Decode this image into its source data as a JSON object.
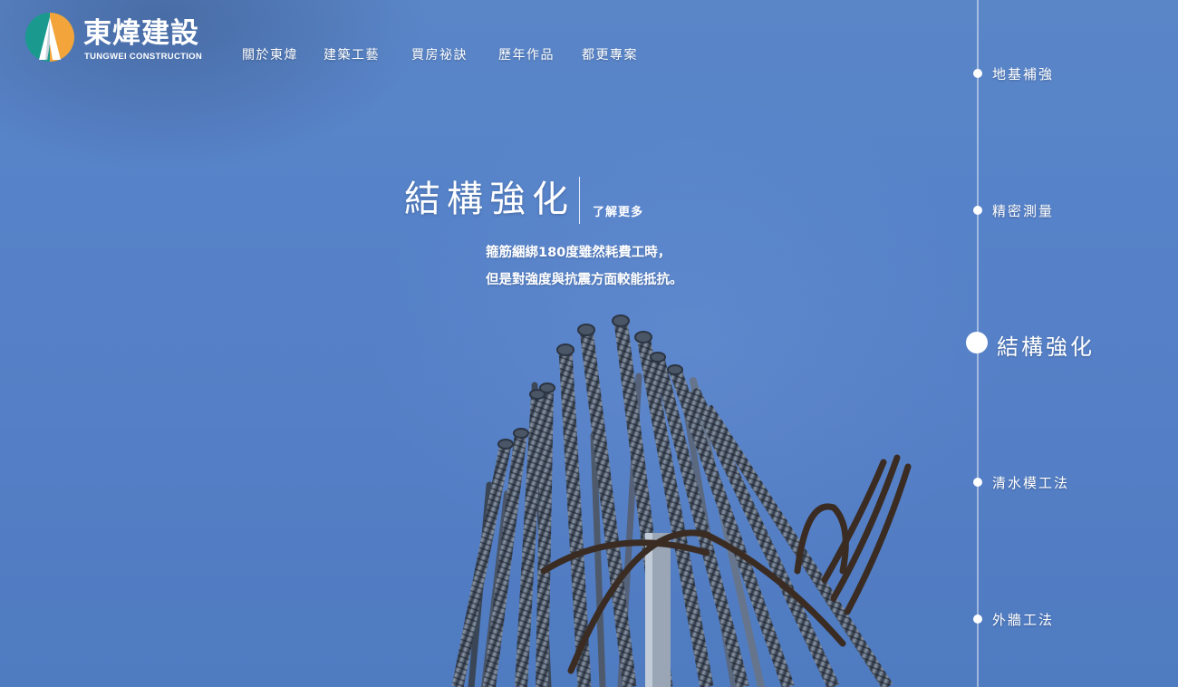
{
  "brand": {
    "name": "東煒建設",
    "subtitle": "TUNGWEI CONSTRUCTION",
    "colors": {
      "teal": "#1a9a8e",
      "orange": "#f3a43a",
      "white": "#ffffff"
    }
  },
  "nav": {
    "items": [
      {
        "label": "關於東煒"
      },
      {
        "label": "建築工藝"
      },
      {
        "label": "買房祕訣"
      },
      {
        "label": "歷年作品"
      },
      {
        "label": "都更專案"
      }
    ]
  },
  "hero": {
    "title": "結構強化",
    "more": "了解更多",
    "desc_lines": [
      "箍筋綑綁180度雖然耗費工時，",
      "但是對強度與抗震方面較能抵抗。"
    ],
    "background_color": "#5682c9"
  },
  "timeline": {
    "active_index": 2,
    "items": [
      {
        "label": "地基補強"
      },
      {
        "label": "精密測量"
      },
      {
        "label": "結構強化"
      },
      {
        "label": "清水模工法"
      },
      {
        "label": "外牆工法"
      }
    ]
  }
}
